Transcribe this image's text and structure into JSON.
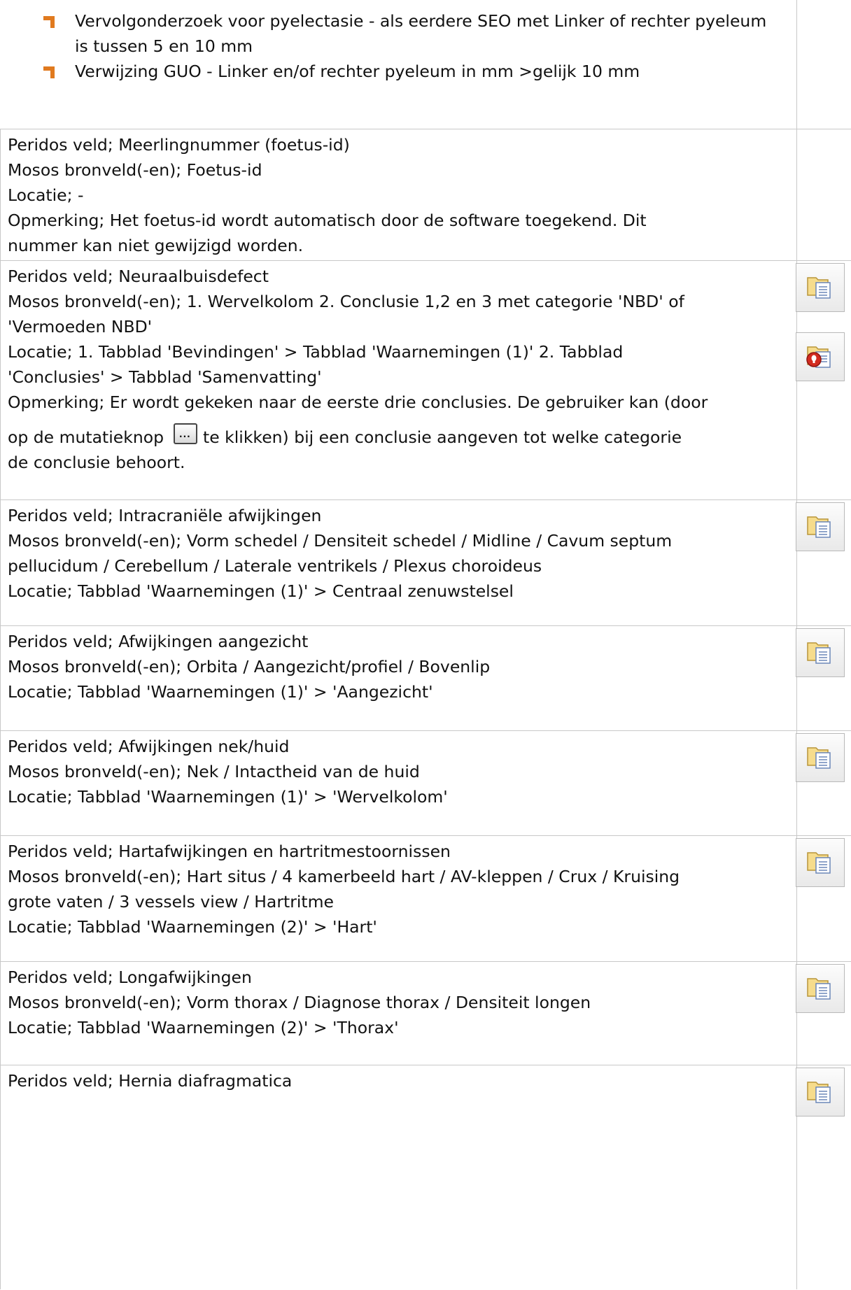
{
  "bullets": [
    {
      "text": "Vervolgonderzoek voor pyelectasie - als eerdere SEO met Linker of rechter pyeleum is tussen 5 en 10 mm"
    },
    {
      "text": "Verwijzing GUO - Linker en/of rechter pyeleum in mm >gelijk 10 mm"
    }
  ],
  "rows": [
    {
      "lines": [
        "Peridos veld; Meerlingnummer (foetus-id)",
        "Mosos bronveld(-en); Foetus-id",
        "Locatie; -",
        "Opmerking; Het foetus-id wordt automatisch door de software toegekend. Dit",
        "nummer kan niet gewijzigd worden."
      ]
    },
    {
      "lines": [
        "Peridos veld; Neuraalbuisdefect",
        "Mosos bronveld(-en); 1. Wervelkolom 2. Conclusie 1,2 en 3 met categorie 'NBD' of",
        "'Vermoeden NBD'",
        "Locatie; 1. Tabblad 'Bevindingen' > Tabblad 'Waarnemingen (1)' 2. Tabblad",
        "'Conclusies' > Tabblad 'Samenvatting'",
        "Opmerking; Er wordt gekeken naar de eerste drie conclusies. De gebruiker kan (door"
      ],
      "opmerking_pre": "op de mutatieknop",
      "opmerking_post": "te klikken) bij een conclusie aangeven tot welke categorie",
      "opmerking_last": "de conclusie behoort.",
      "mutation_button_label": "..."
    },
    {
      "lines": [
        "Peridos veld; Intracraniële afwijkingen",
        "Mosos bronveld(-en); Vorm schedel / Densiteit schedel / Midline / Cavum septum",
        "pellucidum / Cerebellum / Laterale ventrikels / Plexus choroideus",
        "Locatie; Tabblad 'Waarnemingen (1)' > Centraal zenuwstelsel"
      ]
    },
    {
      "lines": [
        "Peridos veld; Afwijkingen aangezicht",
        "Mosos bronveld(-en); Orbita / Aangezicht/profiel / Bovenlip",
        "Locatie; Tabblad 'Waarnemingen (1)' > 'Aangezicht'"
      ]
    },
    {
      "lines": [
        "Peridos veld; Afwijkingen nek/huid",
        "Mosos bronveld(-en); Nek / Intactheid van de huid",
        "Locatie; Tabblad 'Waarnemingen (1)' > 'Wervelkolom'"
      ]
    },
    {
      "lines": [
        "Peridos veld; Hartafwijkingen en hartritmestoornissen",
        "Mosos bronveld(-en); Hart situs / 4 kamerbeeld hart / AV-kleppen / Crux / Kruising",
        "grote vaten / 3 vessels view / Hartritme",
        "Locatie; Tabblad 'Waarnemingen (2)' > 'Hart'"
      ]
    },
    {
      "lines": [
        "Peridos veld; Longafwijkingen",
        "Mosos bronveld(-en); Vorm thorax / Diagnose thorax / Densiteit longen",
        "Locatie; Tabblad 'Waarnemingen (2)' > 'Thorax'"
      ]
    },
    {
      "lines": [
        "Peridos veld; Hernia diafragmatica"
      ]
    }
  ],
  "colors": {
    "bullet": "#e07a1f",
    "border": "#c8c8c8",
    "text": "#111111"
  },
  "icons": {
    "document_copy": "document-copy-icon",
    "document_warning": "document-warning-icon",
    "bullet": "orange-corner-bullet"
  }
}
